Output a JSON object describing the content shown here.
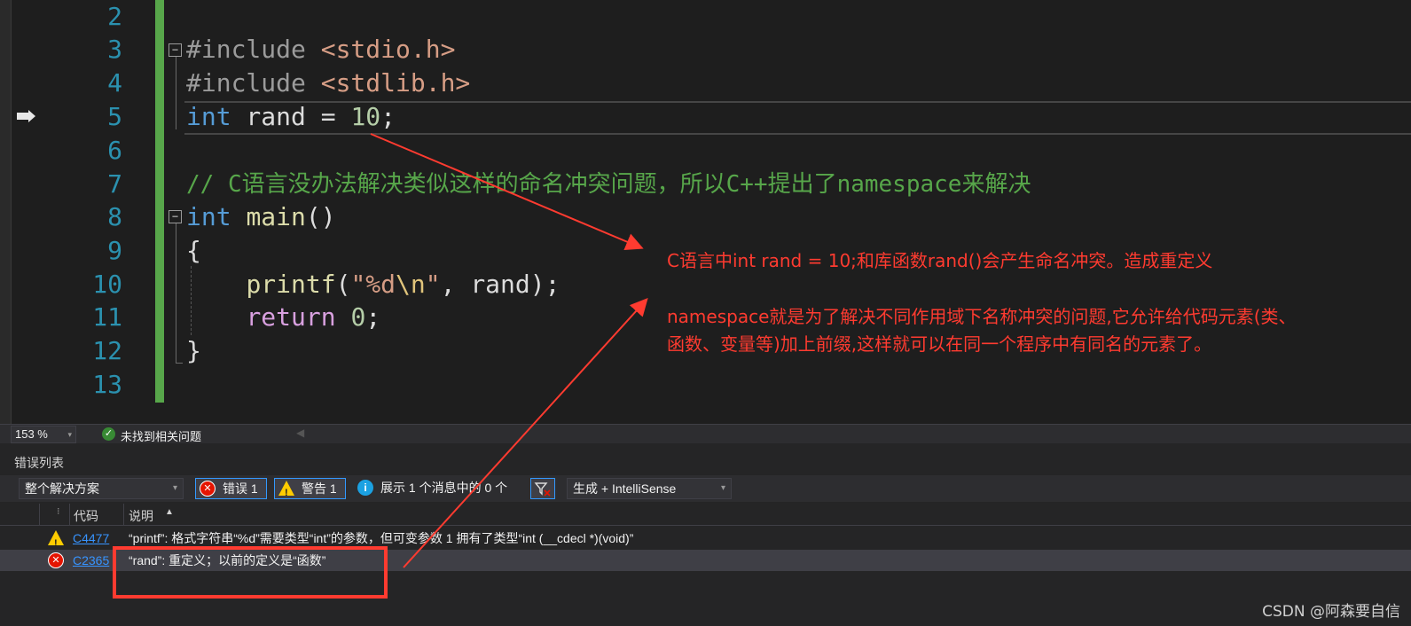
{
  "editor": {
    "line_numbers": [
      "2",
      "3",
      "4",
      "5",
      "6",
      "7",
      "8",
      "9",
      "10",
      "11",
      "12",
      "13"
    ],
    "lines": {
      "l3_directive": "#include",
      "l3_header": "<stdio.h>",
      "l4_directive": "#include",
      "l4_header": "<stdlib.h>",
      "l5_kw": "int",
      "l5_rest": " rand = ",
      "l5_num": "10",
      "l5_end": ";",
      "l7_comment": "// C语言没办法解决类似这样的命名冲突问题，所以C++提出了namespace来解决",
      "l8_kw": "int",
      "l8_fn": "main",
      "l8_rest": "()",
      "l9": "{",
      "l10_fn": "printf",
      "l10_open": "(",
      "l10_str1": "\"%d",
      "l10_esc": "\\n",
      "l10_str2": "\"",
      "l10_rest": ", rand);",
      "l11_kw": "return",
      "l11_num": "0",
      "l11_end": ";",
      "l12": "}"
    }
  },
  "annotations": {
    "line1": "C语言中int rand = 10;和库函数rand()会产生命名冲突。造成重定义",
    "line2": "namespace就是为了解决不同作用域下名称冲突的问题,它允许给代码元素(类、",
    "line3": "函数、变量等)加上前缀,这样就可以在同一个程序中有同名的元素了。",
    "color": "#ff3b30"
  },
  "statusbar": {
    "zoom": "153 %",
    "issues": "未找到相关问题"
  },
  "error_list": {
    "title": "错误列表",
    "scope": "整个解决方案",
    "errors_label": "错误 1",
    "warnings_label": "警告 1",
    "messages_label": "展示 1 个消息中的 0 个",
    "build_filter": "生成 + IntelliSense",
    "columns": {
      "code": "代码",
      "description": "说明"
    },
    "rows": [
      {
        "type": "warning",
        "code": "C4477",
        "description": "“printf”: 格式字符串“%d”需要类型“int”的参数，但可变参数 1 拥有了类型“int (__cdecl *)(void)”"
      },
      {
        "type": "error",
        "code": "C2365",
        "description": "“rand”: 重定义；以前的定义是“函数”"
      }
    ]
  },
  "watermark": "CSDN @阿森要自信"
}
